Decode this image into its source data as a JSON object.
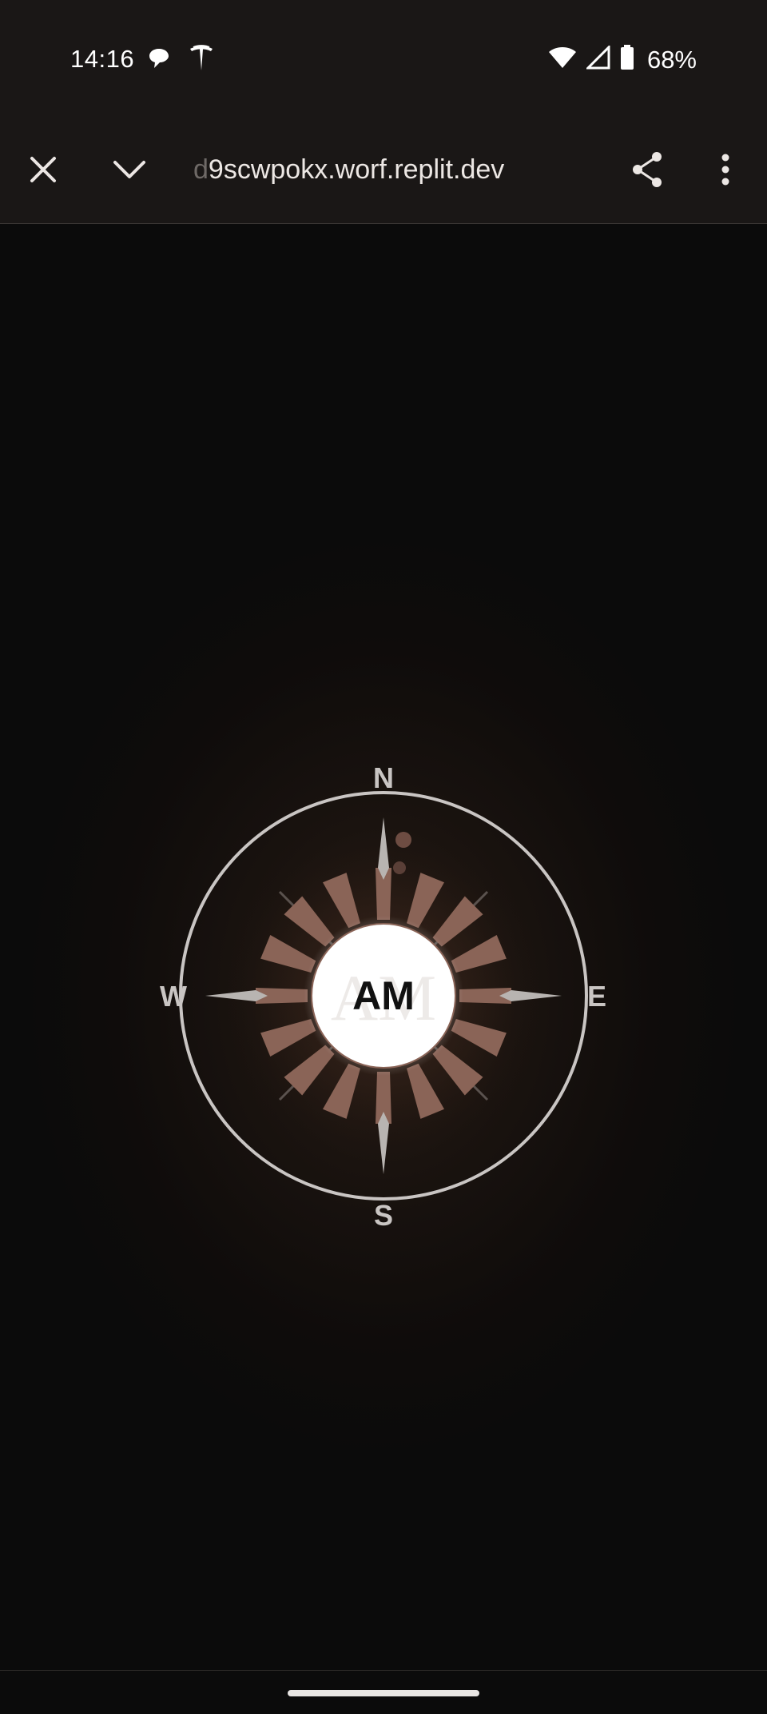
{
  "status_bar": {
    "time": "14:16",
    "left_icons": [
      "chat-bubble-icon",
      "tesla-icon"
    ],
    "right_icons": [
      "wifi-icon",
      "signal-icon",
      "battery-icon"
    ],
    "battery_percent": "68%"
  },
  "browser_toolbar": {
    "url_faded_prefix": "d",
    "url": "9scwpokx.worf.replit.dev",
    "close_icon": "close-icon",
    "collapse_icon": "chevron-down-icon",
    "share_icon": "share-icon",
    "menu_icon": "more-vert-icon"
  },
  "compass": {
    "center_text": "AM",
    "watermark_text": "AM",
    "directions": {
      "north": "N",
      "east": "E",
      "south": "S",
      "west": "W"
    },
    "colors": {
      "ring": "#c9c5c3",
      "needle": "#b8b4b1",
      "ray": "#8a6457",
      "center_fill": "#ffffff",
      "center_text": "#111111"
    }
  }
}
